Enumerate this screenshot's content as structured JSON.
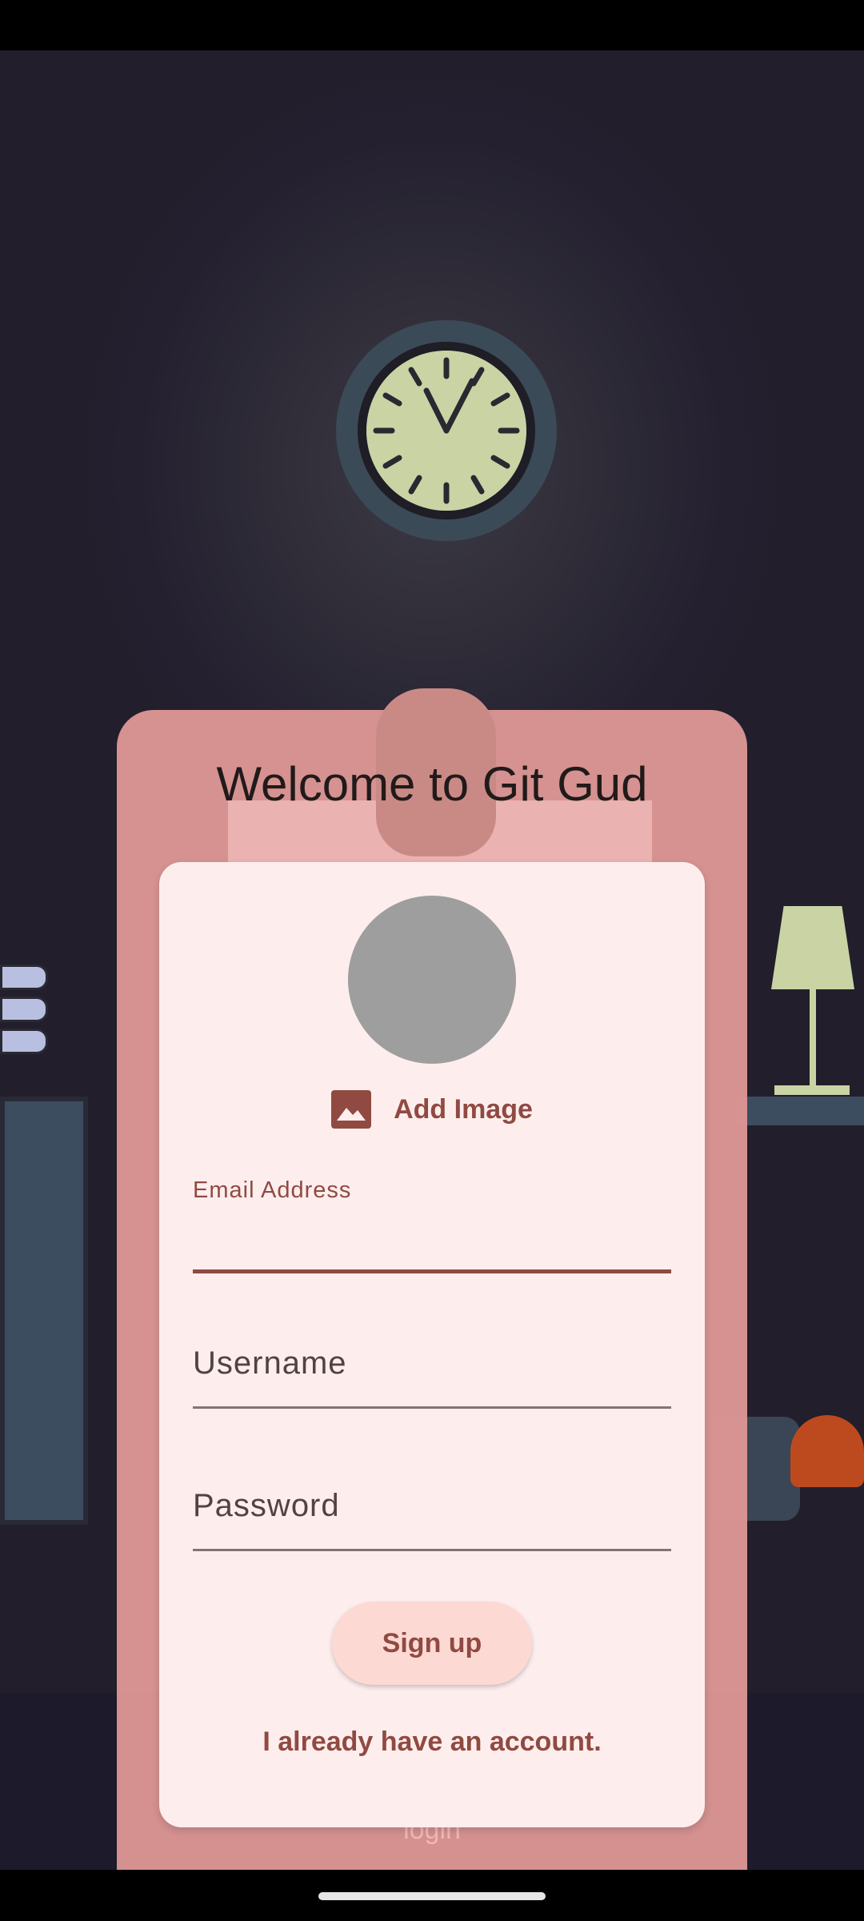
{
  "app": {
    "title": "Welcome to Git Gud",
    "ghost_text": "login"
  },
  "profile": {
    "add_image_label": "Add Image"
  },
  "form": {
    "email": {
      "label": "Email Address",
      "value": ""
    },
    "username": {
      "label": "Username",
      "value": ""
    },
    "password": {
      "label": "Password",
      "value": ""
    }
  },
  "actions": {
    "signup_label": "Sign up",
    "have_account_label": "I already have an account."
  },
  "colors": {
    "primary": "#904a42",
    "card": "#fdeeed",
    "outer_card": "#db9694",
    "background": "#231f2d",
    "button": "#fdd9d3"
  },
  "icons": {
    "add_image": "image-icon",
    "clock": "clock-icon"
  }
}
